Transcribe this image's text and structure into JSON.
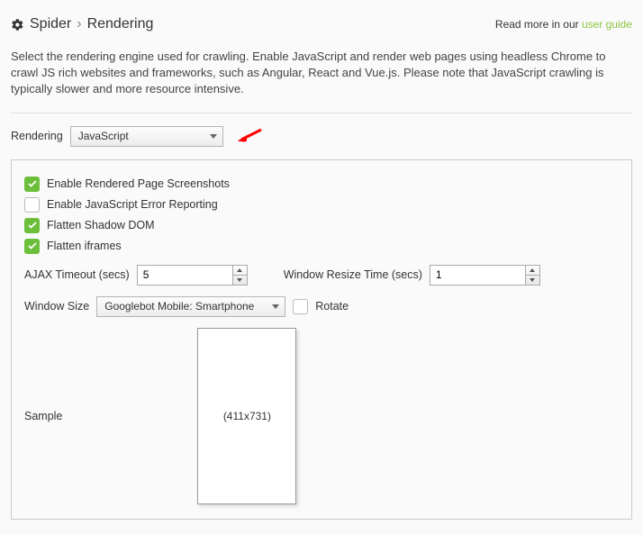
{
  "header": {
    "crumb_root": "Spider",
    "crumb_sep": "›",
    "crumb_leaf": "Rendering",
    "readmore_text": "Read more in our ",
    "readmore_link": "user guide"
  },
  "description": "Select the rendering engine used for crawling. Enable JavaScript and render web pages using headless Chrome to crawl JS rich websites and frameworks, such as Angular, React and Vue.js. Please note that JavaScript crawling is typically slower and more resource intensive.",
  "rendering": {
    "label": "Rendering",
    "value": "JavaScript"
  },
  "options": {
    "screenshots": {
      "label": "Enable Rendered Page Screenshots",
      "checked": true
    },
    "jserror": {
      "label": "Enable JavaScript Error Reporting",
      "checked": false
    },
    "shadowdom": {
      "label": "Flatten Shadow DOM",
      "checked": true
    },
    "iframes": {
      "label": "Flatten iframes",
      "checked": true
    }
  },
  "ajax": {
    "label": "AJAX Timeout (secs)",
    "value": "5"
  },
  "resize": {
    "label": "Window Resize Time (secs)",
    "value": "1"
  },
  "winsize": {
    "label": "Window Size",
    "value": "Googlebot Mobile: Smartphone"
  },
  "rotate": {
    "label": "Rotate",
    "checked": false
  },
  "sample": {
    "label": "Sample",
    "dims": "(411x731)"
  }
}
